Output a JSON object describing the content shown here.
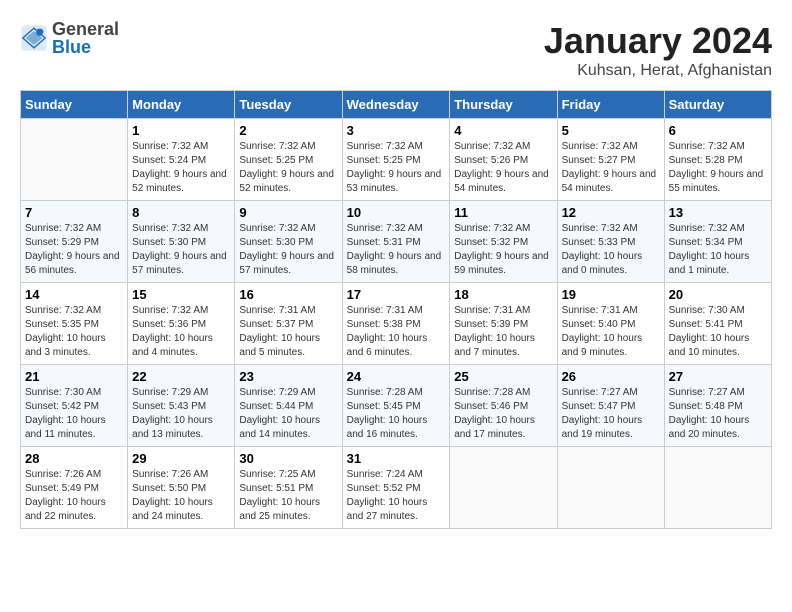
{
  "header": {
    "logo_general": "General",
    "logo_blue": "Blue",
    "month_title": "January 2024",
    "location": "Kuhsan, Herat, Afghanistan"
  },
  "weekdays": [
    "Sunday",
    "Monday",
    "Tuesday",
    "Wednesday",
    "Thursday",
    "Friday",
    "Saturday"
  ],
  "weeks": [
    [
      {
        "day": "",
        "sunrise": "",
        "sunset": "",
        "daylight": ""
      },
      {
        "day": "1",
        "sunrise": "7:32 AM",
        "sunset": "5:24 PM",
        "daylight": "9 hours and 52 minutes."
      },
      {
        "day": "2",
        "sunrise": "7:32 AM",
        "sunset": "5:25 PM",
        "daylight": "9 hours and 52 minutes."
      },
      {
        "day": "3",
        "sunrise": "7:32 AM",
        "sunset": "5:25 PM",
        "daylight": "9 hours and 53 minutes."
      },
      {
        "day": "4",
        "sunrise": "7:32 AM",
        "sunset": "5:26 PM",
        "daylight": "9 hours and 54 minutes."
      },
      {
        "day": "5",
        "sunrise": "7:32 AM",
        "sunset": "5:27 PM",
        "daylight": "9 hours and 54 minutes."
      },
      {
        "day": "6",
        "sunrise": "7:32 AM",
        "sunset": "5:28 PM",
        "daylight": "9 hours and 55 minutes."
      }
    ],
    [
      {
        "day": "7",
        "sunrise": "7:32 AM",
        "sunset": "5:29 PM",
        "daylight": "9 hours and 56 minutes."
      },
      {
        "day": "8",
        "sunrise": "7:32 AM",
        "sunset": "5:30 PM",
        "daylight": "9 hours and 57 minutes."
      },
      {
        "day": "9",
        "sunrise": "7:32 AM",
        "sunset": "5:30 PM",
        "daylight": "9 hours and 57 minutes."
      },
      {
        "day": "10",
        "sunrise": "7:32 AM",
        "sunset": "5:31 PM",
        "daylight": "9 hours and 58 minutes."
      },
      {
        "day": "11",
        "sunrise": "7:32 AM",
        "sunset": "5:32 PM",
        "daylight": "9 hours and 59 minutes."
      },
      {
        "day": "12",
        "sunrise": "7:32 AM",
        "sunset": "5:33 PM",
        "daylight": "10 hours and 0 minutes."
      },
      {
        "day": "13",
        "sunrise": "7:32 AM",
        "sunset": "5:34 PM",
        "daylight": "10 hours and 1 minute."
      }
    ],
    [
      {
        "day": "14",
        "sunrise": "7:32 AM",
        "sunset": "5:35 PM",
        "daylight": "10 hours and 3 minutes."
      },
      {
        "day": "15",
        "sunrise": "7:32 AM",
        "sunset": "5:36 PM",
        "daylight": "10 hours and 4 minutes."
      },
      {
        "day": "16",
        "sunrise": "7:31 AM",
        "sunset": "5:37 PM",
        "daylight": "10 hours and 5 minutes."
      },
      {
        "day": "17",
        "sunrise": "7:31 AM",
        "sunset": "5:38 PM",
        "daylight": "10 hours and 6 minutes."
      },
      {
        "day": "18",
        "sunrise": "7:31 AM",
        "sunset": "5:39 PM",
        "daylight": "10 hours and 7 minutes."
      },
      {
        "day": "19",
        "sunrise": "7:31 AM",
        "sunset": "5:40 PM",
        "daylight": "10 hours and 9 minutes."
      },
      {
        "day": "20",
        "sunrise": "7:30 AM",
        "sunset": "5:41 PM",
        "daylight": "10 hours and 10 minutes."
      }
    ],
    [
      {
        "day": "21",
        "sunrise": "7:30 AM",
        "sunset": "5:42 PM",
        "daylight": "10 hours and 11 minutes."
      },
      {
        "day": "22",
        "sunrise": "7:29 AM",
        "sunset": "5:43 PM",
        "daylight": "10 hours and 13 minutes."
      },
      {
        "day": "23",
        "sunrise": "7:29 AM",
        "sunset": "5:44 PM",
        "daylight": "10 hours and 14 minutes."
      },
      {
        "day": "24",
        "sunrise": "7:28 AM",
        "sunset": "5:45 PM",
        "daylight": "10 hours and 16 minutes."
      },
      {
        "day": "25",
        "sunrise": "7:28 AM",
        "sunset": "5:46 PM",
        "daylight": "10 hours and 17 minutes."
      },
      {
        "day": "26",
        "sunrise": "7:27 AM",
        "sunset": "5:47 PM",
        "daylight": "10 hours and 19 minutes."
      },
      {
        "day": "27",
        "sunrise": "7:27 AM",
        "sunset": "5:48 PM",
        "daylight": "10 hours and 20 minutes."
      }
    ],
    [
      {
        "day": "28",
        "sunrise": "7:26 AM",
        "sunset": "5:49 PM",
        "daylight": "10 hours and 22 minutes."
      },
      {
        "day": "29",
        "sunrise": "7:26 AM",
        "sunset": "5:50 PM",
        "daylight": "10 hours and 24 minutes."
      },
      {
        "day": "30",
        "sunrise": "7:25 AM",
        "sunset": "5:51 PM",
        "daylight": "10 hours and 25 minutes."
      },
      {
        "day": "31",
        "sunrise": "7:24 AM",
        "sunset": "5:52 PM",
        "daylight": "10 hours and 27 minutes."
      },
      {
        "day": "",
        "sunrise": "",
        "sunset": "",
        "daylight": ""
      },
      {
        "day": "",
        "sunrise": "",
        "sunset": "",
        "daylight": ""
      },
      {
        "day": "",
        "sunrise": "",
        "sunset": "",
        "daylight": ""
      }
    ]
  ]
}
